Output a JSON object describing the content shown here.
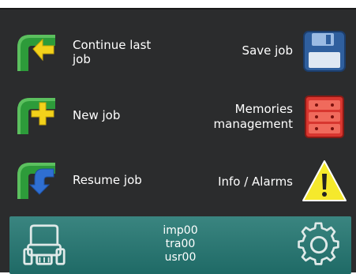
{
  "menu": {
    "continue_label": "Continue last job",
    "new_label": "New job",
    "resume_label": "Resume job",
    "save_label": "Save job",
    "memories_line1": "Memories",
    "memories_line2": "management",
    "info_label": "Info / Alarms"
  },
  "status": {
    "lines": [
      "imp00",
      "tra00",
      "usr00"
    ]
  },
  "colors": {
    "screen_bg": "#2b2c2d",
    "status_bar": "#2a7873",
    "green": "#2d9b3a",
    "yellow_arrow": "#f3d21b",
    "blue_arrow": "#2f6fd1",
    "warning_yellow": "#f5e92c"
  },
  "icons": {
    "continue": "green-pipe-yellow-arrow-icon",
    "new": "green-pipe-plus-icon",
    "resume": "green-pipe-blue-arrow-icon",
    "save": "floppy-disk-icon",
    "memories": "red-server-rack-icon",
    "info": "warning-triangle-icon",
    "vehicle": "tractor-icon",
    "settings": "gear-icon"
  }
}
